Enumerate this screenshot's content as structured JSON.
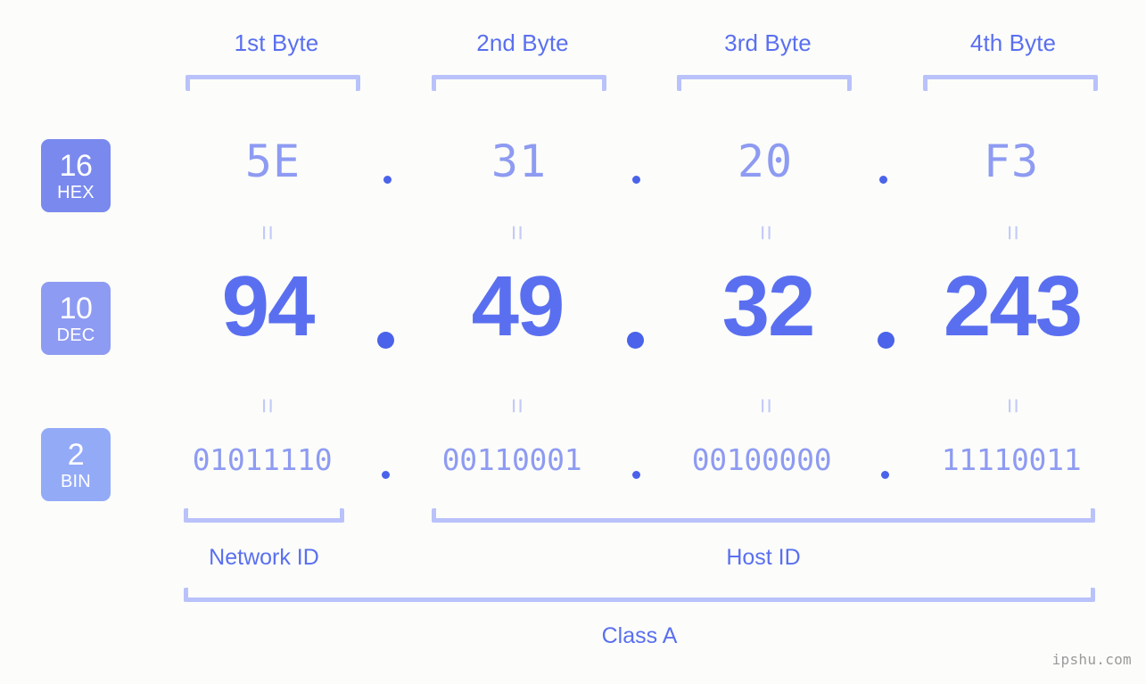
{
  "meta": {
    "background_color": "#fcfdfa",
    "accent_color": "#5a6ff0",
    "light_accent_color": "#8e9bf2",
    "bracket_color": "#b9c2fb",
    "dot_color": "#4a63ea"
  },
  "byte_headers": [
    {
      "label": "1st Byte"
    },
    {
      "label": "2nd Byte"
    },
    {
      "label": "3rd Byte"
    },
    {
      "label": "4th Byte"
    }
  ],
  "bases": [
    {
      "number": "16",
      "name": "HEX",
      "color": "#7a89ee"
    },
    {
      "number": "10",
      "name": "DEC",
      "color": "#8e9bf2"
    },
    {
      "number": "2",
      "name": "BIN",
      "color": "#93aaf7"
    }
  ],
  "rows": {
    "hex": {
      "values": [
        "5E",
        "31",
        "20",
        "F3"
      ]
    },
    "dec": {
      "values": [
        "94",
        "49",
        "32",
        "243"
      ]
    },
    "bin": {
      "values": [
        "01011110",
        "00110001",
        "00100000",
        "11110011"
      ]
    }
  },
  "separators": {
    "dot": ".",
    "equals": "="
  },
  "id_sections": [
    {
      "label": "Network ID"
    },
    {
      "label": "Host ID"
    }
  ],
  "class_section": {
    "label": "Class A"
  },
  "watermark": {
    "text": "ipshu.com"
  }
}
